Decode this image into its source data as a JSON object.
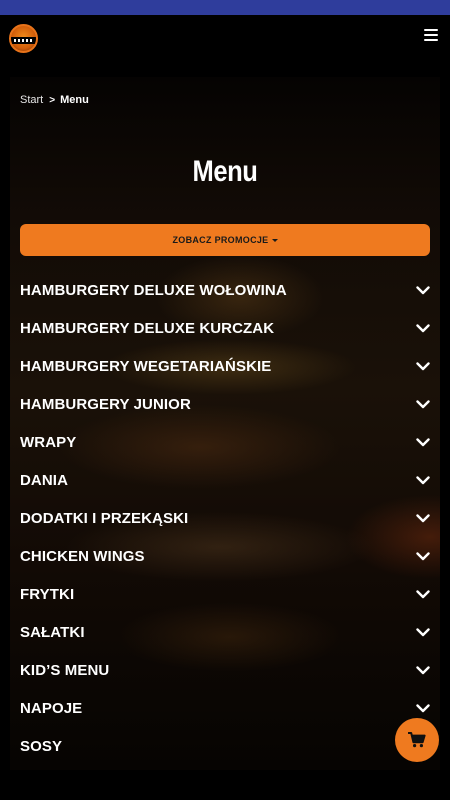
{
  "breadcrumb": {
    "home": "Start",
    "current": "Menu"
  },
  "page": {
    "title": "Menu"
  },
  "promo": {
    "label": "ZOBACZ PROMOCJE"
  },
  "menu": {
    "items": [
      {
        "label": "HAMBURGERY DELUXE WOŁOWINA"
      },
      {
        "label": "HAMBURGERY DELUXE KURCZAK"
      },
      {
        "label": "HAMBURGERY WEGETARIAŃSKIE"
      },
      {
        "label": "HAMBURGERY JUNIOR"
      },
      {
        "label": "WRAPY"
      },
      {
        "label": "DANIA"
      },
      {
        "label": "DODATKI I PRZEKĄSKI"
      },
      {
        "label": "CHICKEN WINGS"
      },
      {
        "label": "FRYTKI"
      },
      {
        "label": "SAŁATKI"
      },
      {
        "label": "KID’S MENU"
      },
      {
        "label": "NAPOJE"
      },
      {
        "label": "SOSY"
      }
    ]
  },
  "icons": {
    "menu": "hamburger-menu-icon",
    "chevron": "chevron-down-icon",
    "cart": "shopping-cart-icon"
  },
  "colors": {
    "accent": "#ef7a1f",
    "statusbar": "#2f3d9c",
    "background": "#000000"
  }
}
